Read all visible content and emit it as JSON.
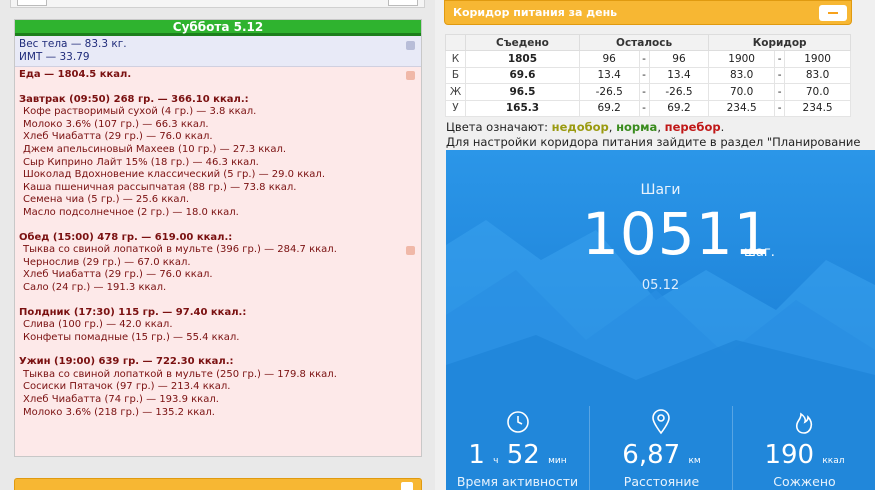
{
  "day": {
    "title": "Суббота 5.12",
    "weight": "Вес тела — 83.3 кг.",
    "bmi": "ИМТ — 33.79",
    "food_total": "Еда — 1804.5 ккал."
  },
  "meals": [
    {
      "title": "Завтрак (09:50) 268 гр. — 366.10 ккал.:",
      "items": [
        "Кофе растворимый сухой (4 гр.) — 3.8 ккал.",
        "Молоко 3.6% (107 гр.) — 66.3 ккал.",
        "Хлеб Чиабатта (29 гр.) — 76.0 ккал.",
        "Джем апельсиновый Махеев (10 гр.) — 27.3 ккал.",
        "Сыр Киприно Лайт 15% (18 гр.) — 46.3 ккал.",
        "Шоколад Вдохновение классический (5 гр.) — 29.0 ккал.",
        "Каша пшеничная рассыпчатая (88 гр.) — 73.8 ккал.",
        "Семена чиа (5 гр.) — 25.6 ккал.",
        "Масло подсолнечное (2 гр.) — 18.0 ккал."
      ]
    },
    {
      "title": "Обед (15:00) 478 гр. — 619.00 ккал.:",
      "items": [
        "Тыква со свиной лопаткой в мульте (396 гр.) — 284.7 ккал.",
        "Чернослив (29 гр.) — 67.0 ккал.",
        "Хлеб Чиабатта (29 гр.) — 76.0 ккал.",
        "Сало (24 гр.) — 191.3 ккал."
      ]
    },
    {
      "title": "Полдник (17:30) 115 гр. — 97.40 ккал.:",
      "items": [
        "Слива (100 гр.) — 42.0 ккал.",
        "Конфеты помадные (15 гр.) — 55.4 ккал."
      ]
    },
    {
      "title": "Ужин (19:00) 639 гр. — 722.30 ккал.:",
      "items": [
        "Тыква со свиной лопаткой в мульте (250 гр.) — 179.8 ккал.",
        "Сосиски Пятачок (97 гр.) — 213.4 ккал.",
        "Хлеб Чиабатта (74 гр.) — 193.9 ккал.",
        "Молоко 3.6% (218 гр.) — 135.2 ккал."
      ]
    }
  ],
  "corridor": {
    "title": "Коридор питания за день",
    "headers": [
      "Съедено",
      "Осталось",
      "Коридор"
    ],
    "rows": [
      {
        "label": "К",
        "eaten": "1805",
        "status": "norm",
        "rem_min": "96",
        "rem_max": "96",
        "cor_min": "1900",
        "cor_max": "1900"
      },
      {
        "label": "Б",
        "eaten": "69.6",
        "status": "under",
        "rem_min": "13.4",
        "rem_max": "13.4",
        "cor_min": "83.0",
        "cor_max": "83.0"
      },
      {
        "label": "Ж",
        "eaten": "96.5",
        "status": "over",
        "rem_min": "-26.5",
        "rem_max": "-26.5",
        "cor_min": "70.0",
        "cor_max": "70.0"
      },
      {
        "label": "У",
        "eaten": "165.3",
        "status": "norm",
        "rem_min": "69.2",
        "rem_max": "69.2",
        "cor_min": "234.5",
        "cor_max": "234.5"
      }
    ],
    "dash": "-",
    "legend_prefix": "Цвета означают: ",
    "legend_under": "недобор",
    "legend_norm": "норма",
    "legend_over": "перебор",
    "legend_sep": ", ",
    "legend_end": ".",
    "note": "Для настройки коридора питания зайдите в раздел \"Планирование"
  },
  "colors": {
    "under": "#9a9a10",
    "norm": "#3a8c1e",
    "over": "#c01818",
    "accent": "#f7b733",
    "fit_blue": "#2b96e8"
  },
  "fit": {
    "steps_label": "Шаги",
    "steps_value": "10511",
    "steps_unit": "шаг.",
    "date": "05.12",
    "stats": [
      {
        "icon": "clock-icon",
        "value_a": "1",
        "unit_a": "ч",
        "value_b": "52",
        "unit_b": "мин",
        "label": "Время активности"
      },
      {
        "icon": "location-pin-icon",
        "value_a": "6,87",
        "unit_a": "км",
        "label": "Расстояние"
      },
      {
        "icon": "flame-icon",
        "value_a": "190",
        "unit_a": "ккал",
        "label": "Сожжено"
      }
    ]
  }
}
